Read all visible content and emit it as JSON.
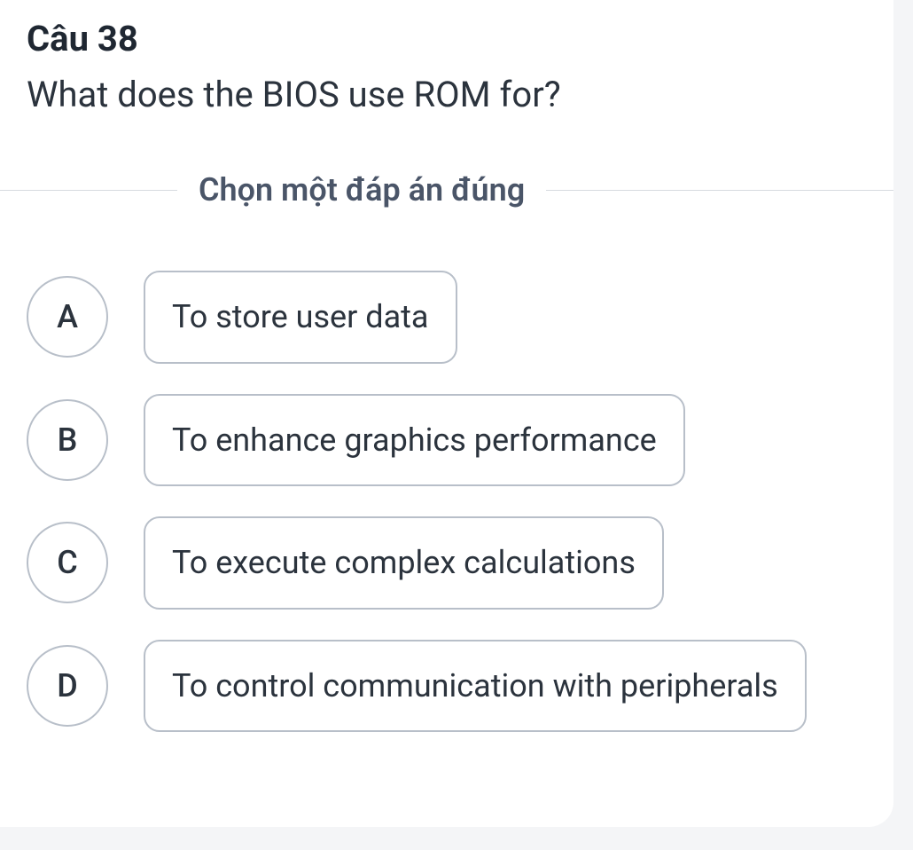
{
  "question": {
    "number_label": "Câu 38",
    "text": "What does the BIOS use ROM for?"
  },
  "instruction": "Chọn một đáp án đúng",
  "options": [
    {
      "letter": "A",
      "text": "To store user data"
    },
    {
      "letter": "B",
      "text": "To enhance graphics performance"
    },
    {
      "letter": "C",
      "text": "To execute complex calculations"
    },
    {
      "letter": "D",
      "text": "To control communication with peripherals"
    }
  ]
}
